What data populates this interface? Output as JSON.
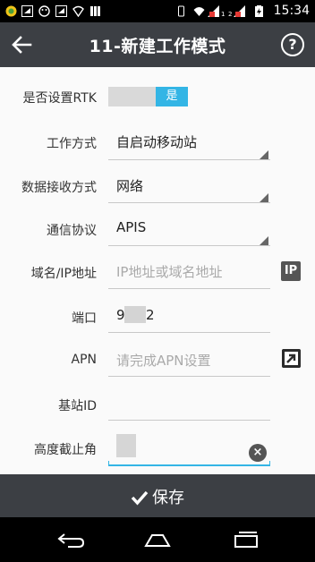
{
  "status_bar": {
    "time": "15:34"
  },
  "app_bar": {
    "title": "11-新建工作模式",
    "help_label": "?"
  },
  "form": {
    "rtk": {
      "label": "是否设置RTK",
      "toggle_value": "是"
    },
    "work_mode": {
      "label": "工作方式",
      "value": "自启动移动站"
    },
    "data_receive": {
      "label": "数据接收方式",
      "value": "网络"
    },
    "protocol": {
      "label": "通信协议",
      "value": "APIS"
    },
    "domain_ip": {
      "label": "域名/IP地址",
      "placeholder": "IP地址或域名地址",
      "button_label": "IP"
    },
    "port": {
      "label": "端口",
      "value_start": "9",
      "value_end": "2"
    },
    "apn": {
      "label": "APN",
      "placeholder": "请完成APN设置"
    },
    "base_id": {
      "label": "基站ID",
      "value": ""
    },
    "cutoff_angle": {
      "label": "高度截止角",
      "value": ""
    }
  },
  "save": {
    "label": "保存"
  },
  "colors": {
    "accent": "#33b5e5",
    "bar": "#3c3f44"
  }
}
